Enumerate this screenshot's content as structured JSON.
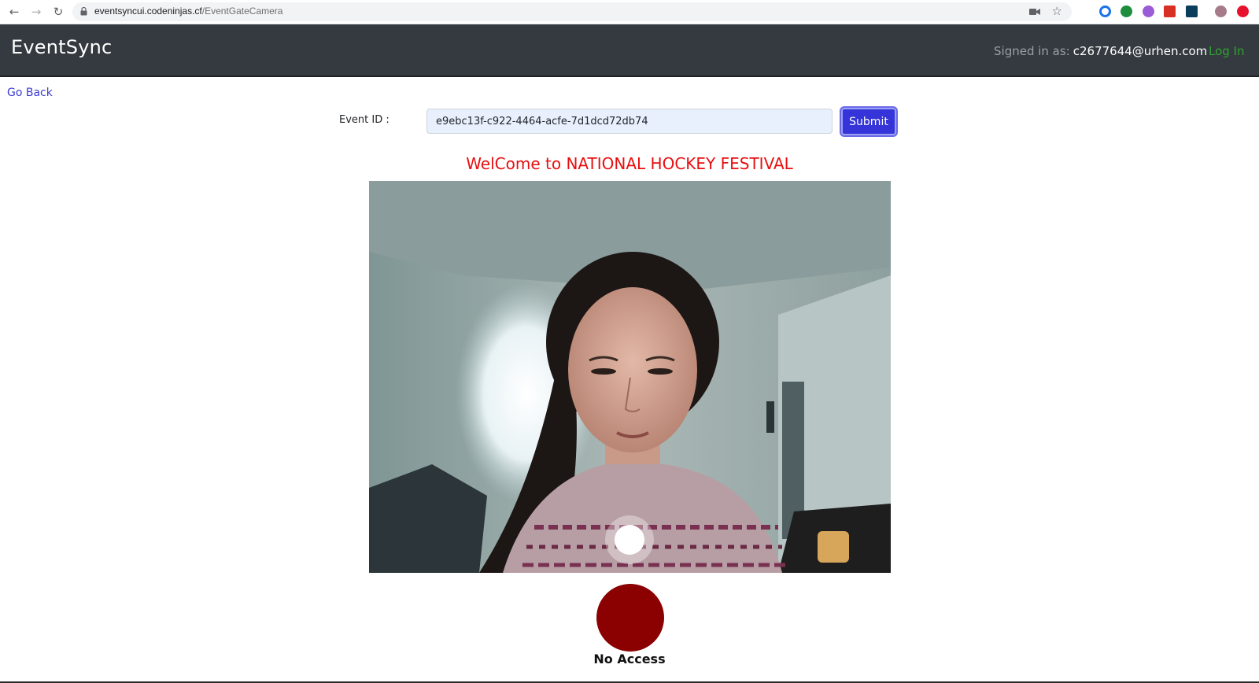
{
  "browser": {
    "url_host": "eventsyncui.codeninjas.cf",
    "url_path": "/EventGateCamera"
  },
  "header": {
    "brand": "EventSync",
    "signed_in_label": "Signed in as:",
    "signed_in_email": "c2677644@urhen.com",
    "login_label": "Log In"
  },
  "main": {
    "go_back_label": "Go Back",
    "event_id_label": "Event ID :",
    "event_id_value": "e9ebc13f-c922-4464-acfe-7d1dcd72db74",
    "submit_label": "Submit",
    "welcome_text": "WelCome to NATIONAL HOCKEY FESTIVAL",
    "status_text": "No Access"
  },
  "icons": [
    "back-arrow-icon",
    "forward-arrow-icon",
    "reload-icon",
    "lock-icon",
    "camera-icon",
    "star-icon",
    "capture-icon"
  ],
  "colors": {
    "header_bg": "#343a40",
    "login_green": "#2ea32e",
    "welcome_red": "#e80f0f",
    "submit_blue": "#3434d8",
    "status_dark_red": "#8b0000"
  }
}
